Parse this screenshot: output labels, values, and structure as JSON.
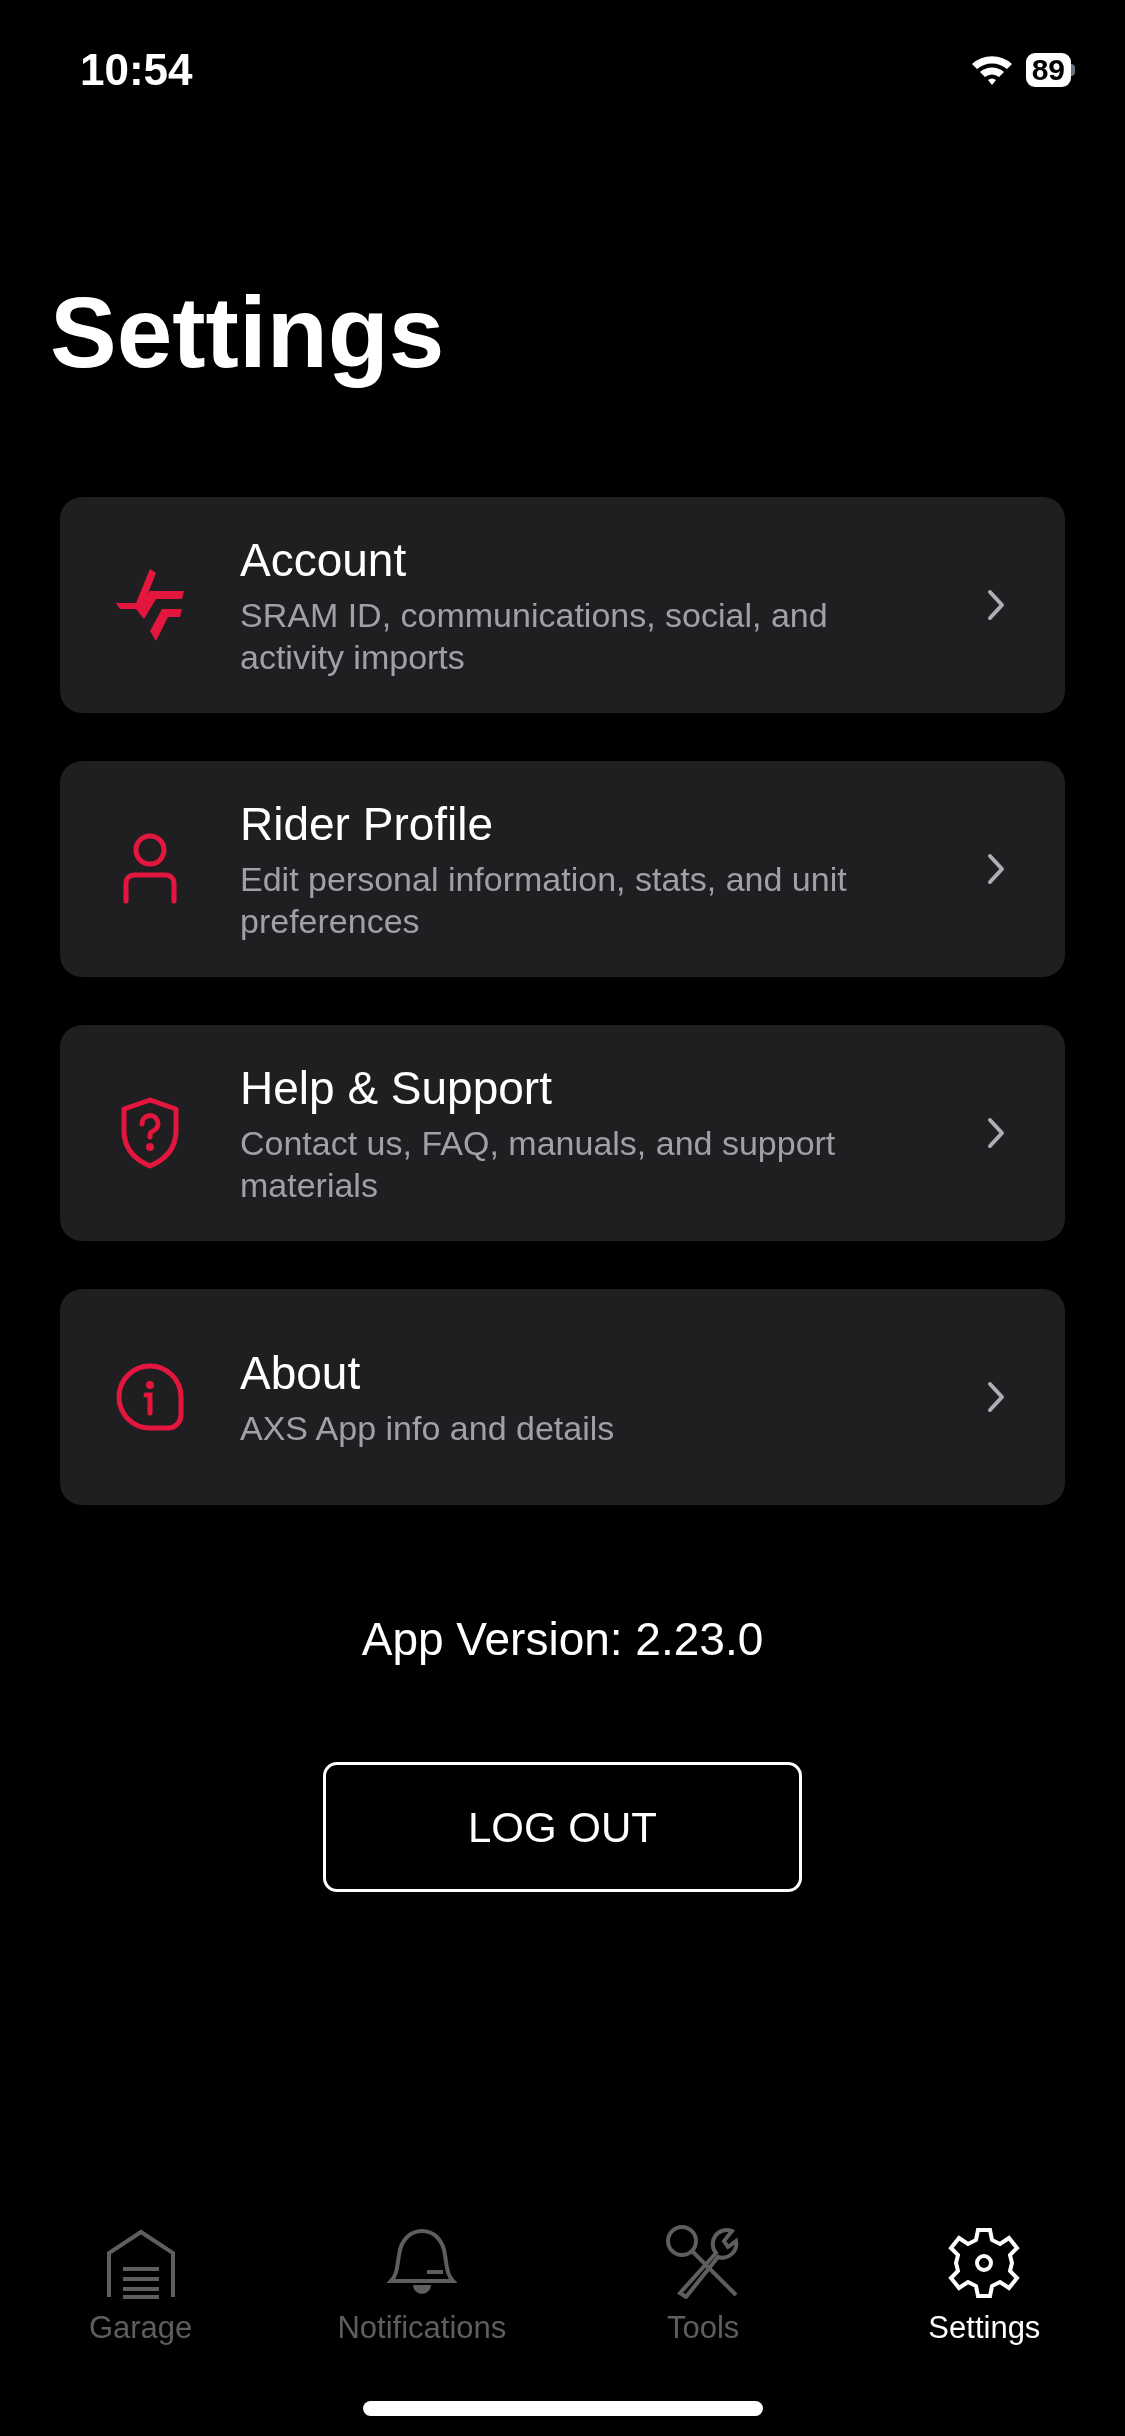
{
  "status_bar": {
    "time": "10:54",
    "battery": "89"
  },
  "title": "Settings",
  "items": [
    {
      "kind": "logo",
      "title": "Account",
      "subtitle": "SRAM ID, communications, social, and activity imports"
    },
    {
      "kind": "person",
      "title": "Rider Profile",
      "subtitle": "Edit personal information, stats, and unit preferences"
    },
    {
      "kind": "shield",
      "title": "Help & Support",
      "subtitle": "Contact us, FAQ, manuals, and support materials"
    },
    {
      "kind": "info",
      "title": "About",
      "subtitle": "AXS App info and details"
    }
  ],
  "app_version": "App Version: 2.23.0",
  "logout_button": "LOG OUT",
  "tab_bar": [
    {
      "kind": "garage",
      "label": "Garage",
      "selected": false
    },
    {
      "kind": "bell",
      "label": "Notifications",
      "selected": false
    },
    {
      "kind": "tools",
      "label": "Tools",
      "selected": false
    },
    {
      "kind": "gear",
      "label": "Settings",
      "selected": true
    }
  ]
}
